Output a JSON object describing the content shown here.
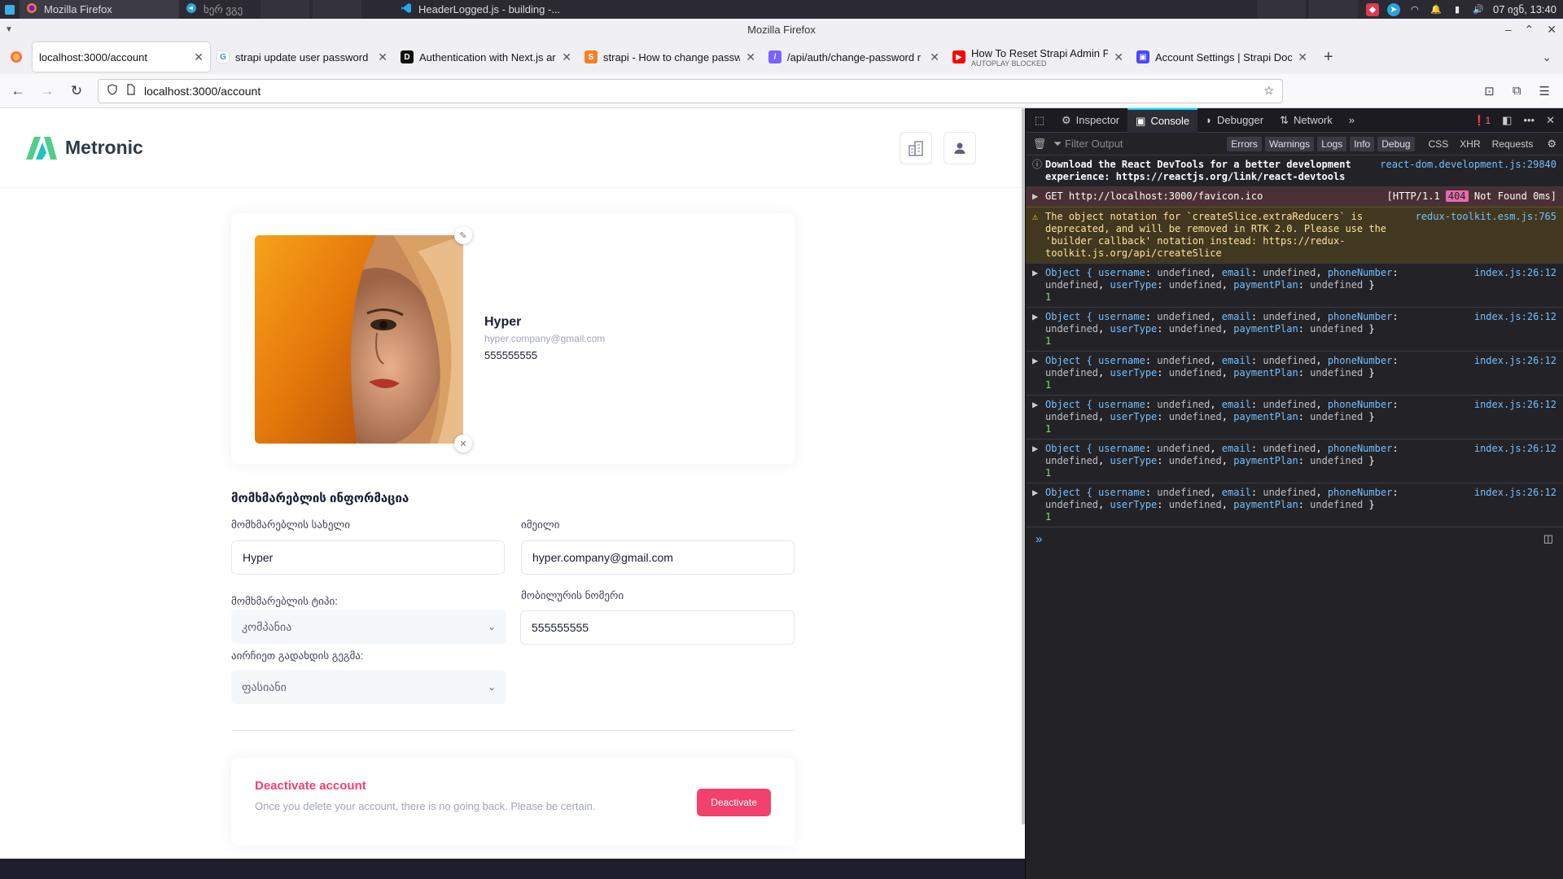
{
  "os_panel": {
    "tasks": [
      {
        "label": "Mozilla Firefox"
      },
      {
        "label": "ხერ ვგე"
      },
      {
        "label": "HeaderLogged.js - building -..."
      }
    ],
    "clock": "07 ივნ, 13:40"
  },
  "firefox": {
    "window_title": "Mozilla Firefox",
    "tabs": [
      {
        "label": "localhost:3000/account",
        "active": true
      },
      {
        "label": "strapi update user password"
      },
      {
        "label": "Authentication with Next.js ar"
      },
      {
        "label": "strapi - How to change passw"
      },
      {
        "label": "/api/auth/change-password r"
      },
      {
        "label": "How To Reset Strapi Admin P",
        "sub": "AUTOPLAY BLOCKED"
      },
      {
        "label": "Account Settings | Strapi Doc"
      }
    ],
    "url": "localhost:3000/account"
  },
  "app": {
    "logo_text": "Metronic",
    "profile": {
      "name": "Hyper",
      "email": "hyper.company@gmail.com",
      "phone": "555555555"
    },
    "form": {
      "section_title": "მომხმარებლის ინფორმაცია",
      "username_label": "მომხმარებლის სახელი",
      "username_value": "Hyper",
      "email_label": "იმეილი",
      "email_value": "hyper.company@gmail.com",
      "usertype_label": "მომხმარებლის ტიპი:",
      "usertype_value": "კომპანია",
      "phone_label": "მობილურის ნომერი",
      "phone_value": "555555555",
      "plan_label": "აირჩიეთ გადახდის გეგმა:",
      "plan_value": "ფასიანი"
    },
    "deactivate": {
      "title": "Deactivate account",
      "description": "Once you delete your account, there is no going back. Please be certain.",
      "button": "Deactivate"
    }
  },
  "devtools": {
    "tabs": [
      "Inspector",
      "Console",
      "Debugger",
      "Network"
    ],
    "error_count": "1",
    "filter_placeholder": "Filter Output",
    "filters": [
      "Errors",
      "Warnings",
      "Logs",
      "Info",
      "Debug"
    ],
    "extra_filters": [
      "CSS",
      "XHR",
      "Requests"
    ],
    "messages": {
      "info_text": "Download the React DevTools for a better development experience: https://reactjs.org/link/react-devtools",
      "info_src": "react-dom.development.js:29840",
      "error_method": "GET http://localhost:3000/favicon.ico",
      "error_status_pre": "[HTTP/1.1",
      "error_status_code": "404",
      "error_status_post": "Not Found 0ms]",
      "warn_text": "The object notation for `createSlice.extraReducers` is deprecated, and will be removed in RTK 2.0. Please use the 'builder callback' notation instead: https://redux-toolkit.js.org/api/createSlice",
      "warn_src": "redux-toolkit.esm.js:765",
      "log_src": "index.js:26:12",
      "log_count": "1"
    }
  },
  "colors": {
    "accent_red": "#f1416c",
    "devtools_bg": "#232327",
    "link_blue": "#75bfff"
  }
}
